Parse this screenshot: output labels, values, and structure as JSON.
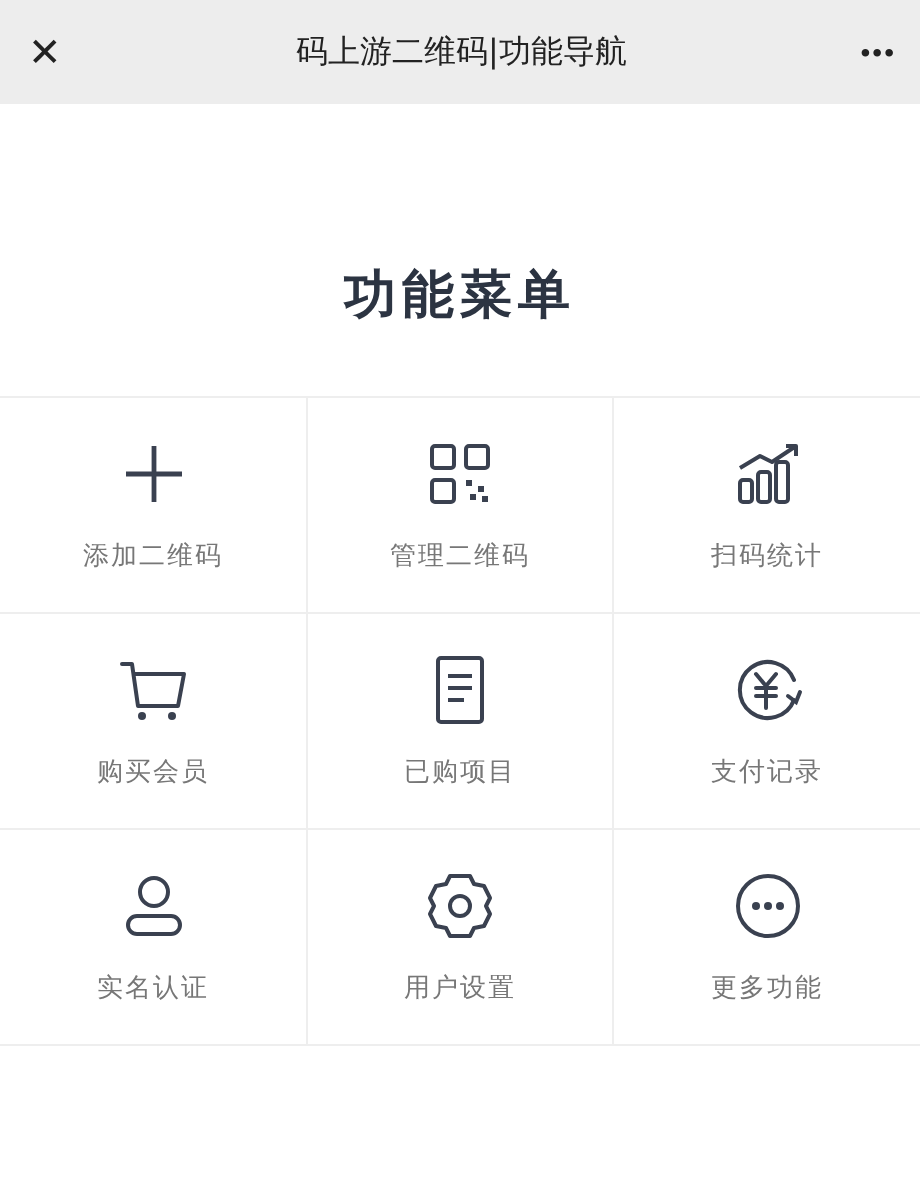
{
  "header": {
    "close": "✕",
    "title": "码上游二维码|功能导航",
    "more": "•••"
  },
  "menu_title": "功能菜单",
  "items": [
    {
      "label": "添加二维码"
    },
    {
      "label": "管理二维码"
    },
    {
      "label": "扫码统计"
    },
    {
      "label": "购买会员"
    },
    {
      "label": "已购项目"
    },
    {
      "label": "支付记录"
    },
    {
      "label": "实名认证"
    },
    {
      "label": "用户设置"
    },
    {
      "label": "更多功能"
    }
  ]
}
